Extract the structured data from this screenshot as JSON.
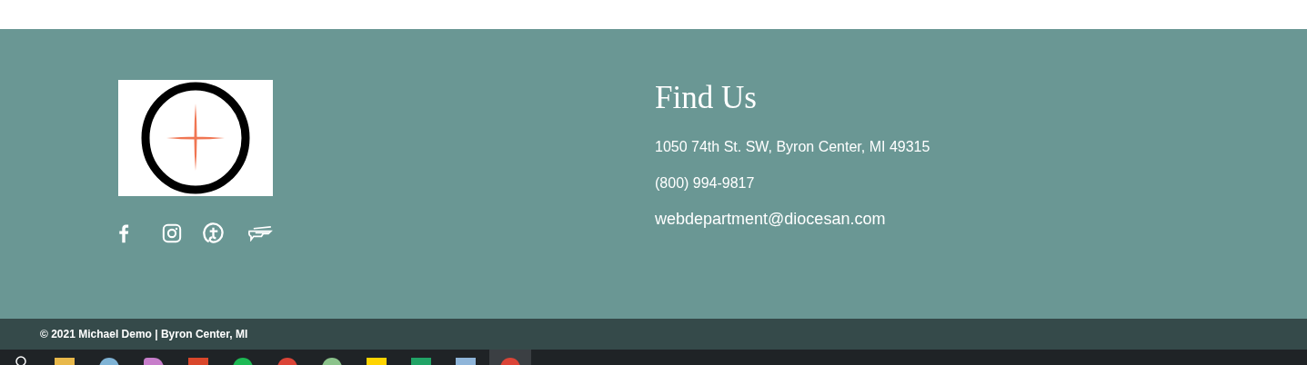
{
  "footer": {
    "social_links": [
      {
        "kind": "facebook"
      },
      {
        "kind": "instagram"
      },
      {
        "kind": "circle"
      },
      {
        "kind": "wing"
      }
    ],
    "find_us": {
      "title": "Find Us",
      "address": "1050 74th St. SW, Byron Center, MI 49315",
      "phone": "(800) 994-9817",
      "email": "webdepartment@diocesan.com"
    },
    "copyright": "© 2021 Michael Demo | Byron Center, MI"
  }
}
